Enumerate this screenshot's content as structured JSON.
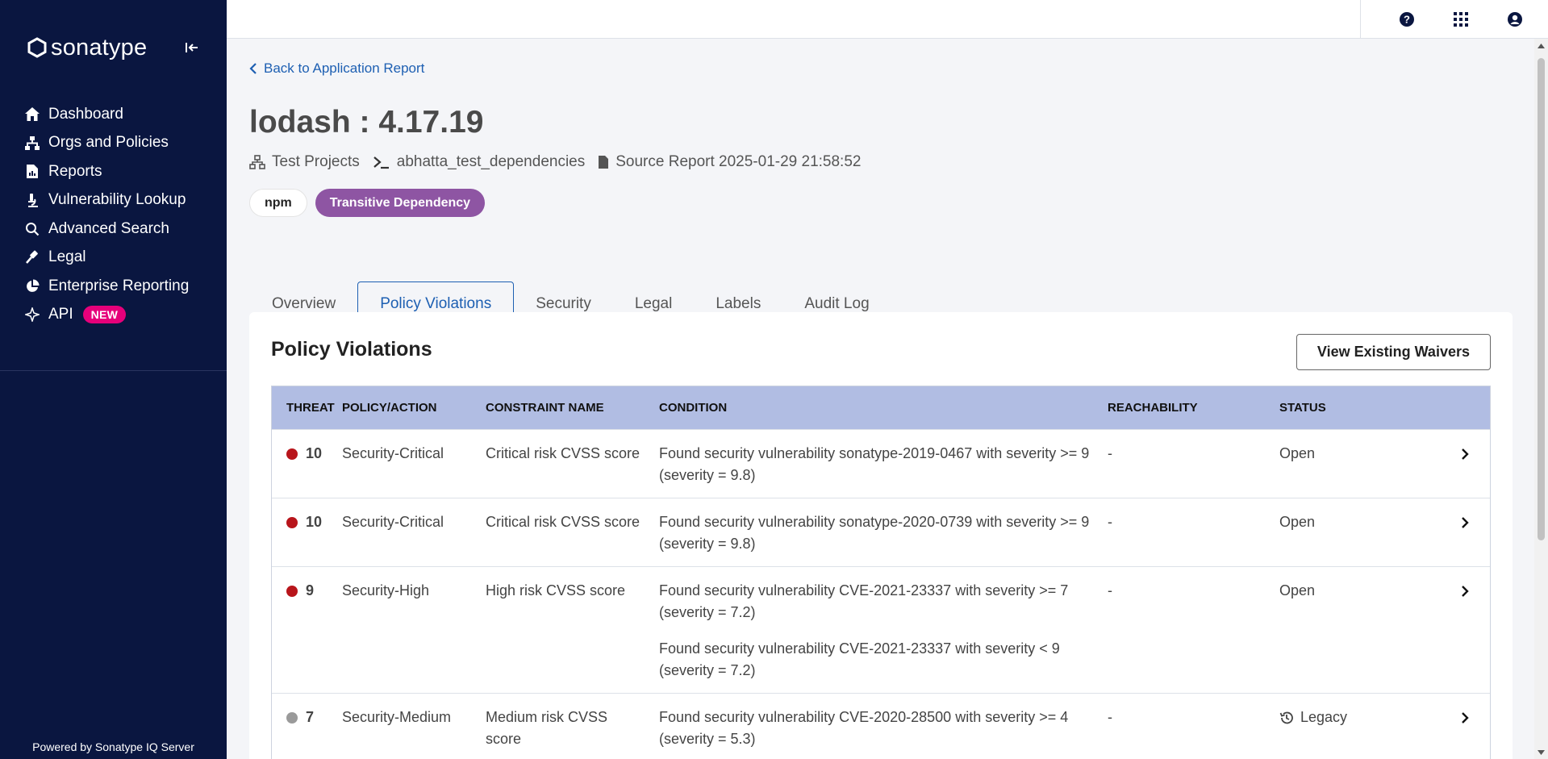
{
  "sidebar": {
    "brand": "sonatype",
    "items": [
      {
        "label": "Dashboard",
        "icon": "home-icon"
      },
      {
        "label": "Orgs and Policies",
        "icon": "org-icon"
      },
      {
        "label": "Reports",
        "icon": "report-icon"
      },
      {
        "label": "Vulnerability Lookup",
        "icon": "microscope-icon"
      },
      {
        "label": "Advanced Search",
        "icon": "search-icon"
      },
      {
        "label": "Legal",
        "icon": "gavel-icon"
      },
      {
        "label": "Enterprise Reporting",
        "icon": "pie-chart-icon"
      },
      {
        "label": "API",
        "icon": "sparkle-icon",
        "badge": "NEW"
      }
    ],
    "footer": "Powered by Sonatype IQ Server"
  },
  "topbar": {
    "icons": [
      "help-icon",
      "apps-grid-icon",
      "user-account-icon"
    ]
  },
  "main": {
    "back_link": "Back to Application Report",
    "title": "lodash : 4.17.19",
    "meta": {
      "organization": "Test Projects",
      "application": "abhatta_test_dependencies",
      "source_report": "Source Report 2025-01-29 21:58:52"
    },
    "chips": {
      "format": "npm",
      "dependency": "Transitive Dependency"
    },
    "tabs": [
      "Overview",
      "Policy Violations",
      "Security",
      "Legal",
      "Labels",
      "Audit Log"
    ],
    "active_tab": "Policy Violations"
  },
  "panel": {
    "title": "Policy Violations",
    "waivers_button": "View Existing Waivers",
    "columns": [
      "THREAT",
      "POLICY/ACTION",
      "CONSTRAINT NAME",
      "CONDITION",
      "REACHABILITY",
      "STATUS"
    ],
    "rows": [
      {
        "threat": "10",
        "threat_color": "#b8151b",
        "policy": "Security-Critical",
        "constraint": "Critical risk CVSS score",
        "conditions": [
          "Found security vulnerability sonatype-2019-0467 with severity >= 9 (severity = 9.8)"
        ],
        "reachability": "-",
        "status": "Open"
      },
      {
        "threat": "10",
        "threat_color": "#b8151b",
        "policy": "Security-Critical",
        "constraint": "Critical risk CVSS score",
        "conditions": [
          "Found security vulnerability sonatype-2020-0739 with severity >= 9 (severity = 9.8)"
        ],
        "reachability": "-",
        "status": "Open"
      },
      {
        "threat": "9",
        "threat_color": "#b8151b",
        "policy": "Security-High",
        "constraint": "High risk CVSS score",
        "conditions": [
          "Found security vulnerability CVE-2021-23337 with severity >= 7 (severity = 7.2)",
          "Found security vulnerability CVE-2021-23337 with severity < 9 (severity = 7.2)"
        ],
        "reachability": "-",
        "status": "Open"
      },
      {
        "threat": "7",
        "threat_color": "#9a9a9a",
        "policy": "Security-Medium",
        "constraint": "Medium risk CVSS score",
        "conditions": [
          "Found security vulnerability CVE-2020-28500 with severity >= 4 (severity = 5.3)"
        ],
        "reachability": "-",
        "status": "Legacy",
        "status_icon": "history-icon"
      }
    ]
  },
  "colors": {
    "sidebar_bg": "#0a1640",
    "accent": "#1d5fb2",
    "table_header": "#b1bde3",
    "chip_purple": "#8e55a3",
    "badge_pink": "#e6007a",
    "threat_red": "#b8151b",
    "threat_gray": "#9a9a9a"
  }
}
